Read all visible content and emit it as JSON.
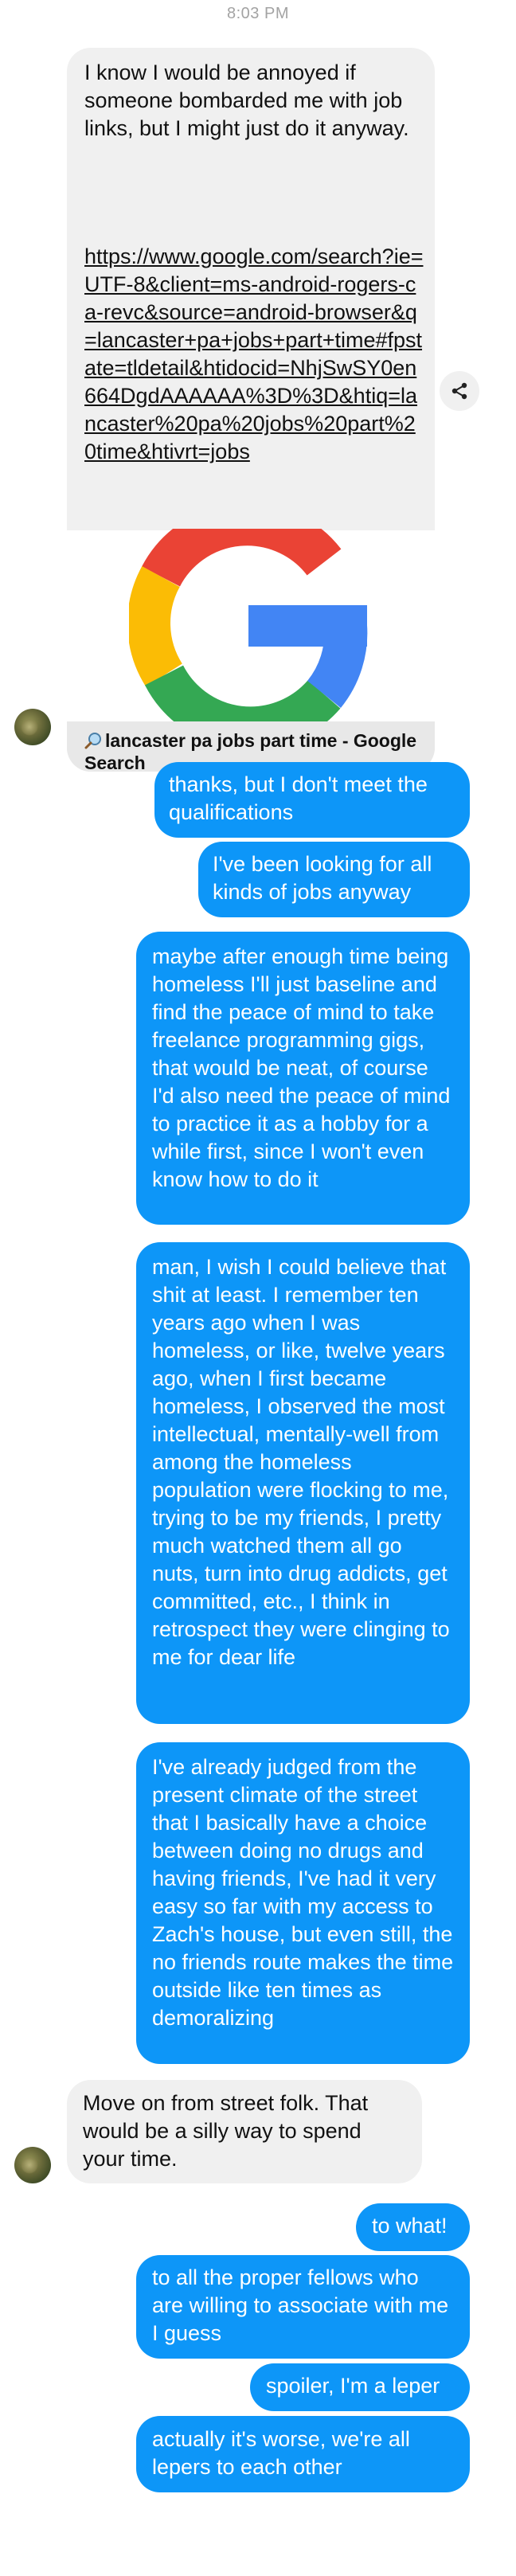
{
  "status": {
    "time": "8:03 PM"
  },
  "messages": [
    {
      "side": "in",
      "type": "link",
      "text": "I know I would be annoyed if someone bombarded me with job links, but I might just do it anyway.",
      "url": "https://www.google.com/search?ie=UTF-8&client=ms-android-rogers-ca-revc&source=android-browser&q=lancaster+pa+jobs+part+time#fpstate=tldetail&htidocid=NhjSwSY0en664DgdAAAAAA%3D%3D&htiq=lancaster%20pa%20jobs%20part%20time&htivrt=jobs",
      "preview_title": "lancaster pa jobs part time - Google Search",
      "icons": [
        "google-logo",
        "magnifier-icon",
        "share-icon"
      ]
    },
    {
      "side": "out",
      "text": "thanks, but I don't meet the qualifications"
    },
    {
      "side": "out",
      "text": "I've been looking for all kinds of jobs anyway"
    },
    {
      "side": "out",
      "text": "maybe after enough time being homeless I'll just baseline and find the peace of mind to take freelance programming gigs, that would be neat, of course I'd also need the peace of mind to practice it as a hobby for a while first, since I won't even know how to do it"
    },
    {
      "side": "out",
      "text": "man, I wish I could believe that shit at least. I remember ten years ago when I was homeless, or like, twelve years ago, when I first became homeless, I observed the most intellectual, mentally-well from among the homeless population were flocking to me, trying to be my friends, I pretty much watched them all go nuts, turn into drug addicts, get committed, etc., I think in retrospect they were clinging to me for dear life"
    },
    {
      "side": "out",
      "text": "I've already judged from the present climate of the street that I basically have a choice between doing no drugs and having friends, I've had it very easy so far with my access to Zach's house, but even still, the no friends route makes the time outside like ten times as demoralizing"
    },
    {
      "side": "in",
      "text": "Move on from street folk. That would be a silly way to spend your time."
    },
    {
      "side": "out",
      "text": "to what!"
    },
    {
      "side": "out",
      "text": "to all the proper fellows who are willing to associate with me I guess"
    },
    {
      "side": "out",
      "text": "spoiler, I'm a leper"
    },
    {
      "side": "out",
      "text": "actually it's worse, we're all lepers to each other"
    }
  ],
  "colors": {
    "outgoing": "#0d96f8",
    "incoming": "#f0f0f0",
    "timestamp": "#a3a3a3"
  }
}
